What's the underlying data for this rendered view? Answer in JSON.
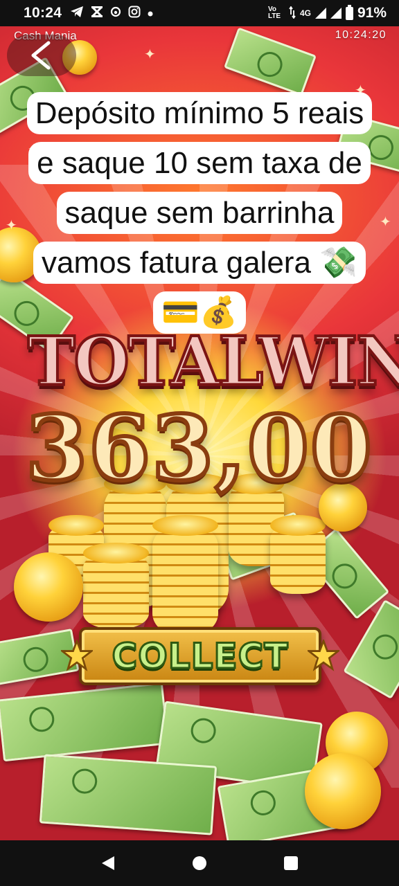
{
  "status_bar": {
    "time": "10:24",
    "left_icons": [
      "telegram-icon",
      "x-icon",
      "threads-icon",
      "instagram-icon",
      "dot-icon"
    ],
    "network": "Vo LTE",
    "network_type": "4G",
    "battery": "91%"
  },
  "game": {
    "app_title": "Cash Mania",
    "clock": "10:24:20",
    "total_win_label": "TOTALWIN",
    "amount": "363,00",
    "collect_label": "COLLECT"
  },
  "caption": {
    "text": "Depósito mínimo 5 reais e saque 10 sem taxa de saque sem barrinha vamos fatura galera 💸💳💰"
  },
  "colors": {
    "caption_bg": "#ffffff",
    "status_bar_bg": "#111111",
    "collect_text": "#c8f08a"
  }
}
